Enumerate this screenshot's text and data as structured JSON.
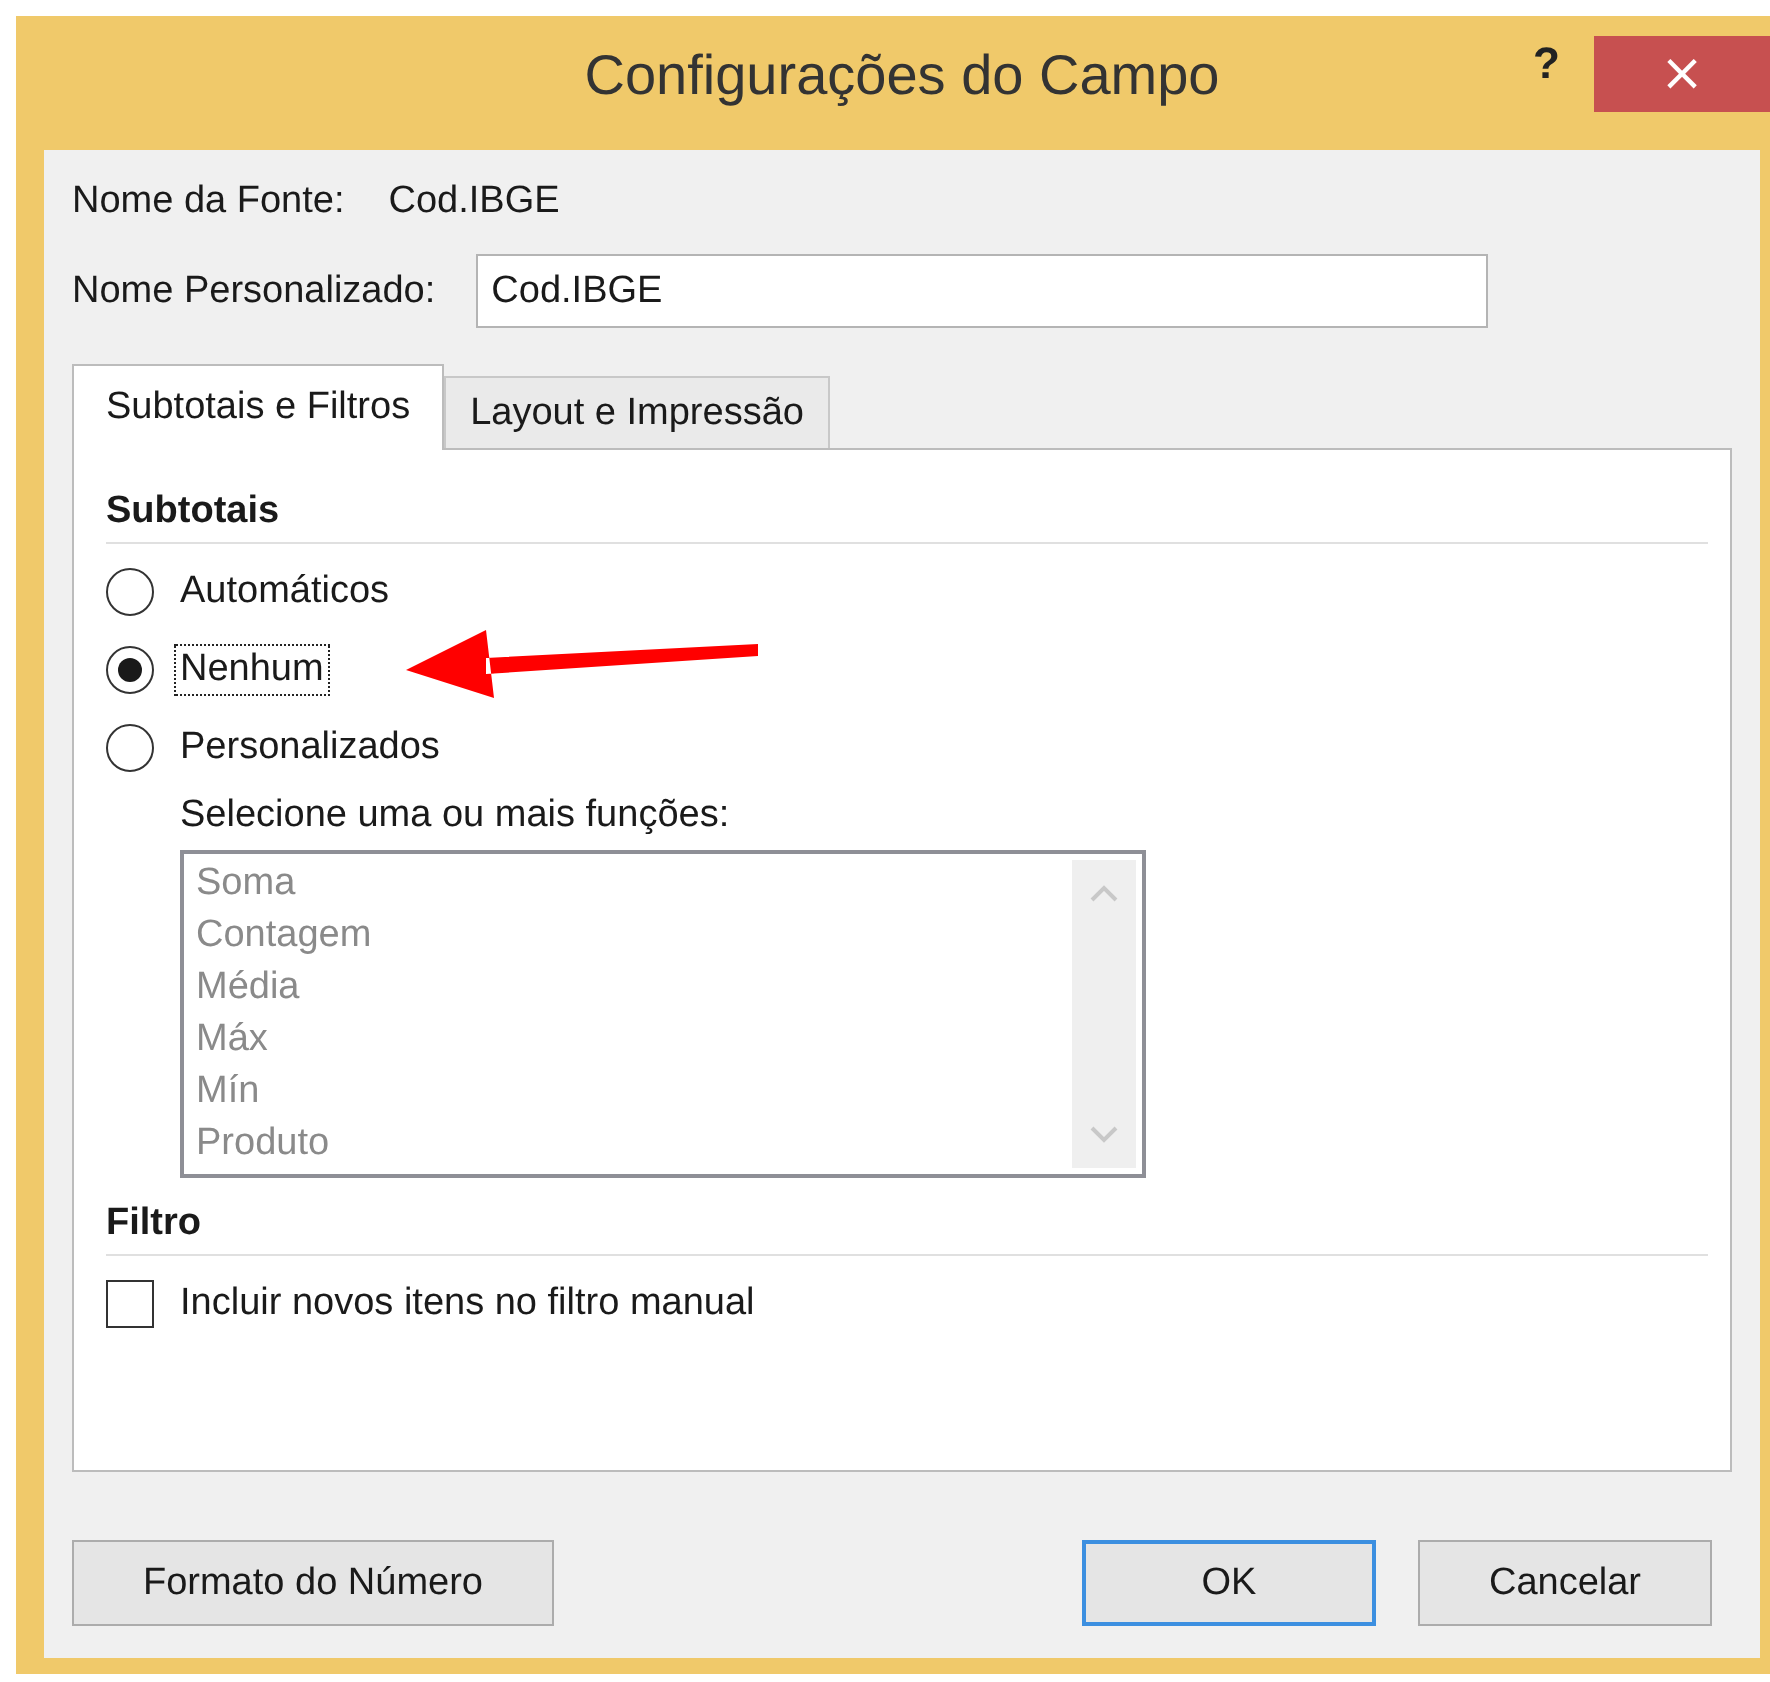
{
  "window": {
    "title": "Configurações do Campo",
    "help_button": "?",
    "close_button": "×"
  },
  "source_name": {
    "label": "Nome da Fonte:",
    "value": "Cod.IBGE"
  },
  "custom_name": {
    "label": "Nome Personalizado:",
    "value": "Cod.IBGE"
  },
  "tabs": [
    {
      "label": "Subtotais e Filtros",
      "selected": true
    },
    {
      "label": "Layout e Impressão",
      "selected": false
    }
  ],
  "subtotals": {
    "heading": "Subtotais",
    "options": [
      {
        "label": "Automáticos",
        "selected": false,
        "focused": false
      },
      {
        "label": "Nenhum",
        "selected": true,
        "focused": true
      },
      {
        "label": "Personalizados",
        "selected": false,
        "focused": false
      }
    ],
    "functions_label": "Selecione uma ou mais funções:",
    "functions": {
      "disabled": true,
      "items": [
        "Soma",
        "Contagem",
        "Média",
        "Máx",
        "Mín",
        "Produto"
      ]
    }
  },
  "filter": {
    "heading": "Filtro",
    "checkbox": {
      "label": "Incluir novos itens no filtro manual",
      "checked": false
    }
  },
  "buttons": [
    {
      "label": "Formato do Número",
      "default": false
    },
    {
      "label": "OK",
      "default": true
    },
    {
      "label": "Cancelar",
      "default": false
    }
  ]
}
